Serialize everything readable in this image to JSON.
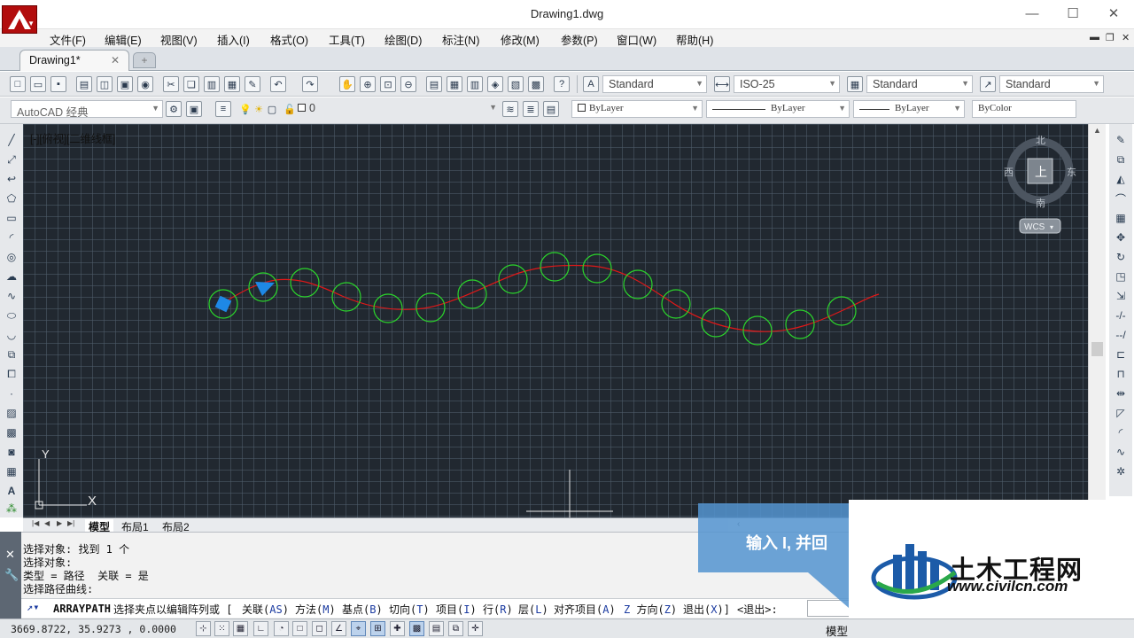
{
  "window": {
    "title": "Drawing1.dwg",
    "min": "—",
    "max": "☐",
    "close": "✕"
  },
  "menu": [
    "文件(F)",
    "编辑(E)",
    "视图(V)",
    "插入(I)",
    "格式(O)",
    "工具(T)",
    "绘图(D)",
    "标注(N)",
    "修改(M)",
    "参数(P)",
    "窗口(W)",
    "帮助(H)"
  ],
  "mdi": {
    "min": "▬",
    "restore": "❐",
    "close": "✕"
  },
  "tabs": {
    "doc": "Drawing1*",
    "close": "✕",
    "new": "+"
  },
  "styles": {
    "text_style": "Standard",
    "dim_style": "ISO-25",
    "table_style": "Standard",
    "mleader_style": "Standard"
  },
  "workspace": "AutoCAD 经典",
  "layer": {
    "current": "0"
  },
  "properties": {
    "color": "ByLayer",
    "linetype": "ByLayer",
    "lineweight": "ByLayer",
    "plotstyle": "ByColor"
  },
  "viewport": {
    "label": "[-][俯视][二维线框]"
  },
  "viewcube": {
    "north": "北",
    "south": "南",
    "east": "东",
    "west": "西",
    "face": "上",
    "wcs": "WCS"
  },
  "ucs": {
    "x": "X",
    "y": "Y"
  },
  "layout_tabs": [
    "模型",
    "布局1",
    "布局2"
  ],
  "command": {
    "history": [
      "选择对象: 找到 1 个",
      "选择对象:",
      "类型 = 路径  关联 = 是",
      "选择路径曲线:"
    ],
    "name": "ARRAYPATH",
    "prompt_text": "选择夹点以编辑阵列或 [",
    "options": [
      {
        "label": "关联(",
        "key": "AS",
        "end": ")"
      },
      {
        "label": "方法(",
        "key": "M",
        "end": ")"
      },
      {
        "label": "基点(",
        "key": "B",
        "end": ")"
      },
      {
        "label": "切向(",
        "key": "T",
        "end": ")"
      },
      {
        "label": "项目(",
        "key": "I",
        "end": ")"
      },
      {
        "label": "行(",
        "key": "R",
        "end": ")"
      },
      {
        "label": "层(",
        "key": "L",
        "end": ")"
      },
      {
        "label": "对齐项目(",
        "key": "A",
        "end": ")"
      },
      {
        "label": "",
        "key": "Z",
        "end": " 方向("
      },
      {
        "label": "",
        "key": "Z",
        "end": ")"
      },
      {
        "label": "退出(",
        "key": "X",
        "end": ")]"
      }
    ],
    "default": "<退出>:"
  },
  "status": {
    "coords": "3669.8722, 35.9273 , 0.0000",
    "model": "模型"
  },
  "tip": {
    "text": "输入 I,  并回"
  },
  "watermark": {
    "title": "土木工程网",
    "url": "www.civilcn.com"
  },
  "colors": {
    "canvas_bg": "#212830",
    "path": "#e01818",
    "circles": "#2bd62b",
    "grip": "#1e88e5"
  }
}
